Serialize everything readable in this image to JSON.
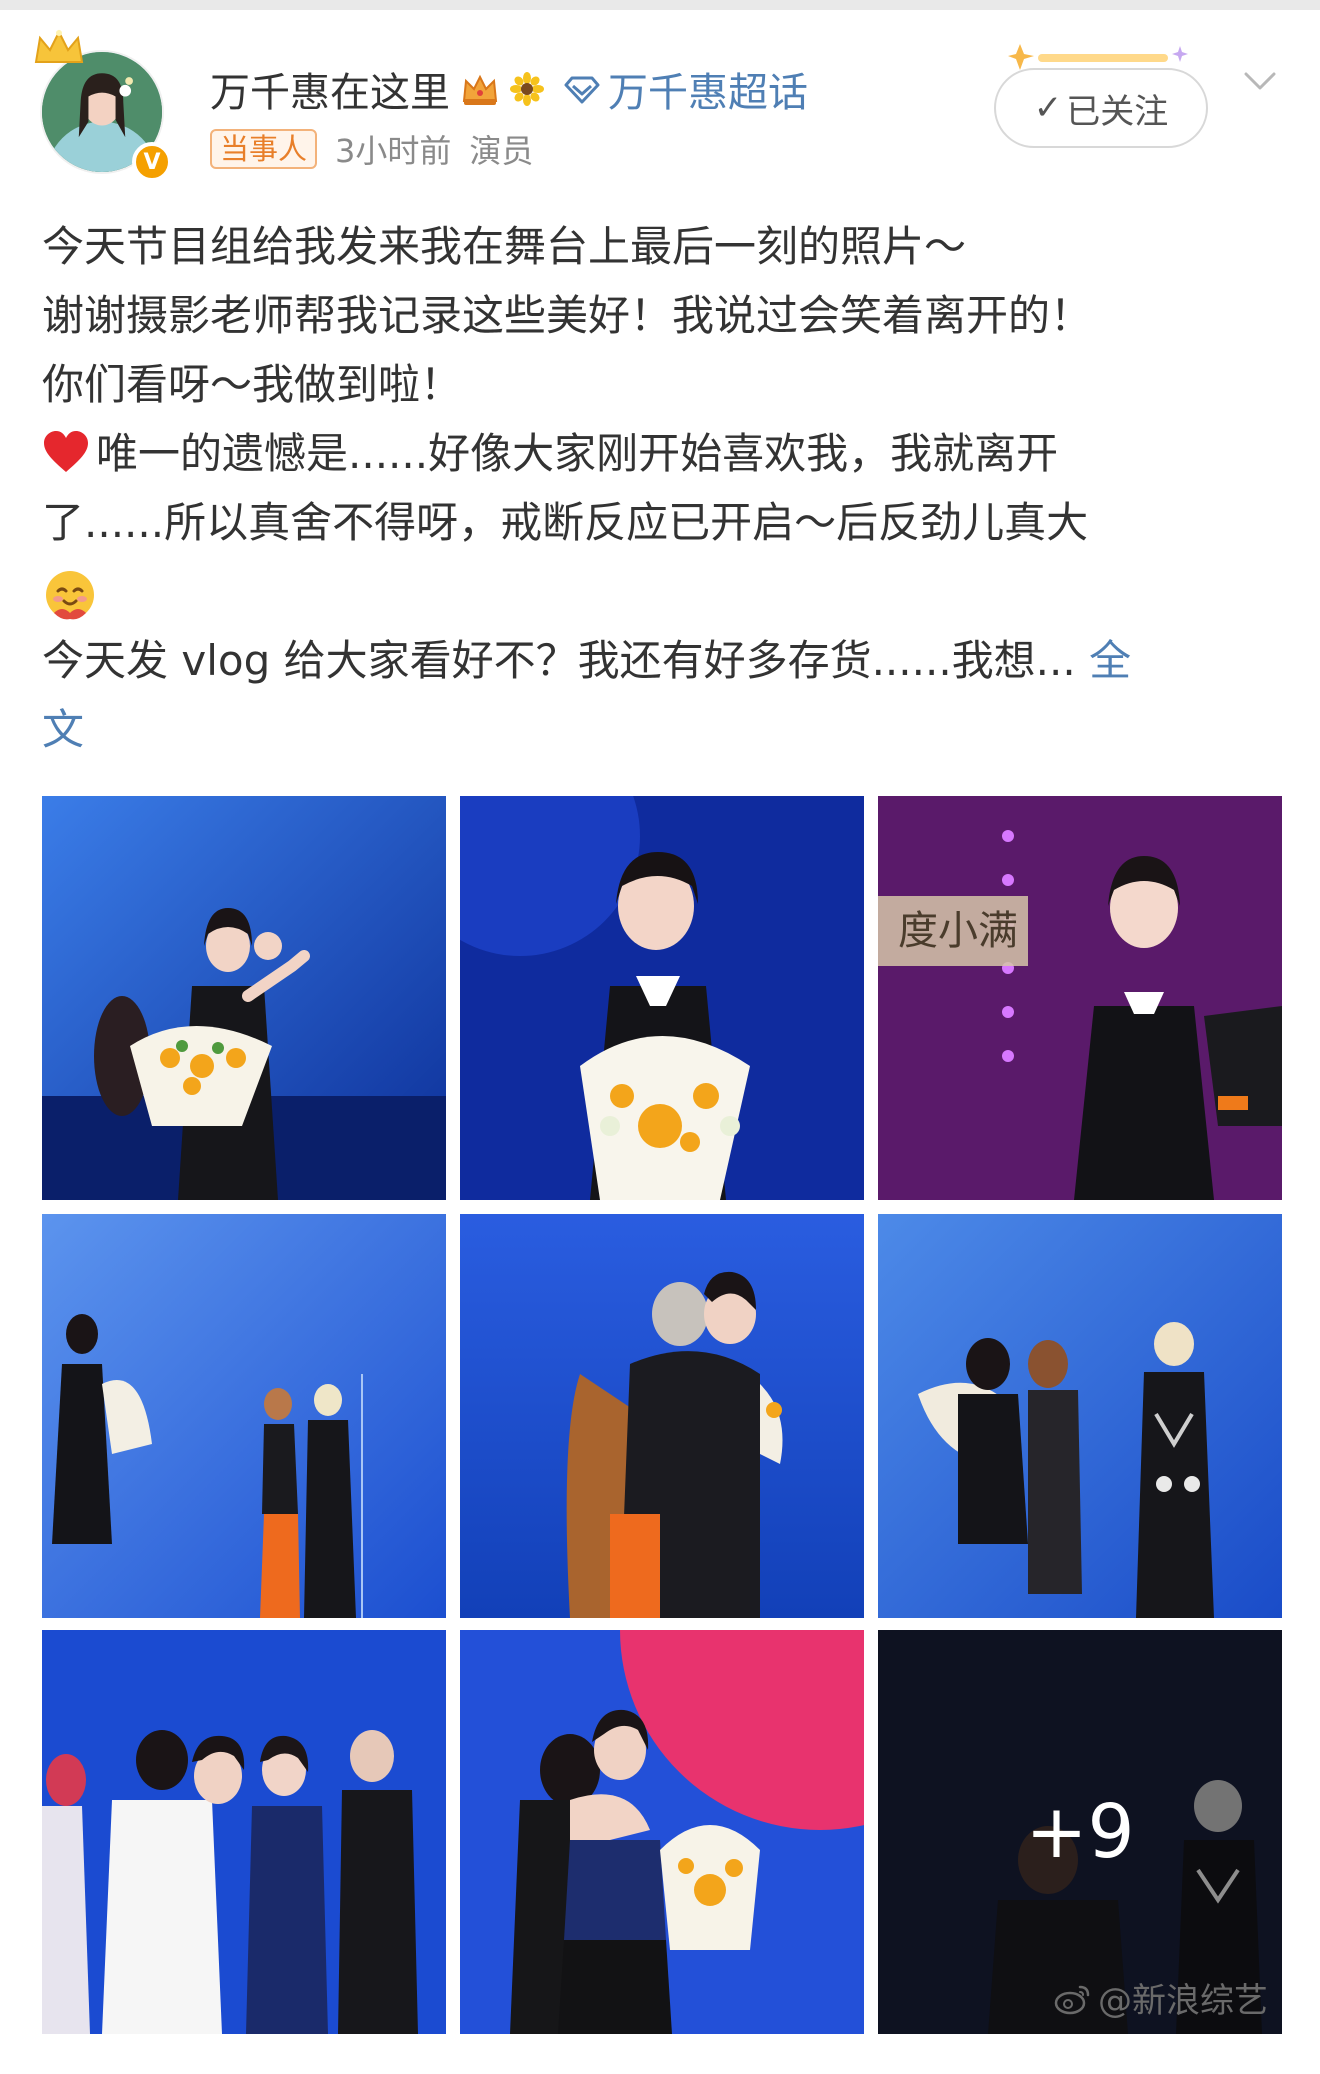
{
  "header": {
    "username": "万千惠在这里",
    "supertopic_label": "万千惠超话",
    "party_tag": "当事人",
    "time": "3小时前",
    "role": "演员",
    "follow_label": "已关注"
  },
  "post": {
    "lines": [
      "今天节目组给我发来我在舞台上最后一刻的照片～",
      "谢谢摄影老师帮我记录这些美好！我说过会笑着离开的！",
      "你们看呀～我做到啦！",
      "唯一的遗憾是......好像大家刚开始喜欢我，我就离开",
      "了......所以真舍不得呀，戒断反应已开启～后反劲儿真大",
      "今天发 vlog 给大家看好不？我还有好多存货......我想... ",
      "文"
    ],
    "more_label": "全"
  },
  "photos": {
    "more_count": "+9",
    "sign_text": "度小满"
  },
  "watermark": {
    "text": "@新浪综艺"
  },
  "colors": {
    "link": "#4f7fb4",
    "stage_blue": "#1f57d6",
    "tag_orange": "#e87f2a",
    "verified": "#f5a000"
  }
}
